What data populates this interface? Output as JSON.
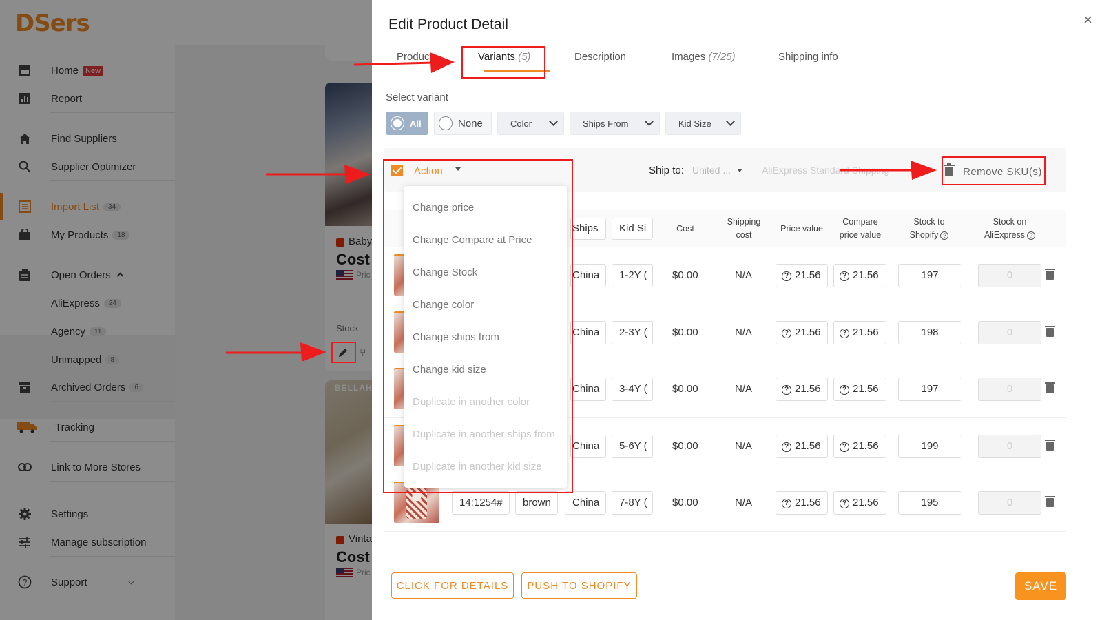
{
  "app": {
    "logo": "DSers",
    "brand_color": "#f08a24",
    "annotation_color": "#ee1c1c"
  },
  "sidebar": {
    "home": {
      "label": "Home",
      "badge": "New",
      "icon": "home-store-icon"
    },
    "report": {
      "label": "Report",
      "icon": "report-chart-icon"
    },
    "find_suppliers": {
      "label": "Find Suppliers",
      "icon": "house-icon"
    },
    "supplier_optimizer": {
      "label": "Supplier Optimizer",
      "icon": "search-icon"
    },
    "import_list": {
      "label": "Import List",
      "count": "34",
      "icon": "list-icon"
    },
    "my_products": {
      "label": "My Products",
      "count": "18",
      "icon": "bag-icon"
    },
    "open_orders": {
      "label": "Open Orders",
      "icon": "clipboard-icon"
    },
    "aliexpress": {
      "label": "AliExpress",
      "count": "24"
    },
    "agency": {
      "label": "Agency",
      "count": "11"
    },
    "unmapped": {
      "label": "Unmapped",
      "count": "8"
    },
    "archived_orders": {
      "label": "Archived Orders",
      "count": "6",
      "icon": "archive-icon"
    },
    "tracking": {
      "label": "Tracking",
      "icon": "truck-icon"
    },
    "link_stores": {
      "label": "Link to More Stores",
      "icon": "link-icon"
    },
    "settings": {
      "label": "Settings",
      "icon": "gear-icon"
    },
    "manage_subscription": {
      "label": "Manage subscription",
      "icon": "sliders-icon"
    },
    "support": {
      "label": "Support",
      "icon": "help-circle-icon"
    }
  },
  "background_cards": {
    "card1": {
      "name": "Baby",
      "cost": "Cost :",
      "price_prefix": "Pric",
      "stock_label": "Stock"
    },
    "card2": {
      "brand": "BELLAH",
      "name": "Vinta",
      "cost": "Cost :",
      "price_prefix": "Pric"
    }
  },
  "drawer": {
    "title": "Edit Product Detail",
    "close": "×",
    "tabs": [
      {
        "label": "Product",
        "count": ""
      },
      {
        "label": "Variants",
        "count": "(5)"
      },
      {
        "label": "Description",
        "count": ""
      },
      {
        "label": "Images",
        "count": "(7/25)"
      },
      {
        "label": "Shipping info",
        "count": ""
      }
    ],
    "select_variant_label": "Select variant",
    "variant_filters": {
      "all": "All",
      "none": "None",
      "color": "Color",
      "ships_from": "Ships From",
      "kid_size": "Kid Size"
    },
    "action_label": "Action",
    "ship_to_label": "Ship to:",
    "ship_to_value": "United ...",
    "shipping_method": "AliExpress Standard Shipping",
    "remove_sku": "Remove SKU(s)",
    "table": {
      "header_inputs": {
        "ships": "Ships",
        "kid_size": "Kid Si"
      },
      "columns": {
        "cost": "Cost",
        "shipping_cost": "Shipping cost",
        "shipping_cost_l1": "Shipping",
        "shipping_cost_l2": "cost",
        "price_value": "Price value",
        "compare_l1": "Compare",
        "compare_l2": "price value",
        "stock_shopify_l1": "Stock to",
        "stock_shopify_l2": "Shopify",
        "stock_ali_l1": "Stock on",
        "stock_ali_l2": "AliExpress"
      },
      "rows": [
        {
          "sku": "",
          "color": "",
          "ships": "China",
          "kid_size": "1-2Y (",
          "cost": "$0.00",
          "shipping": "N/A",
          "price": "21.56",
          "compare": "21.56",
          "stock_shopify": "197",
          "stock_ali": "0"
        },
        {
          "sku": "",
          "color": "",
          "ships": "China",
          "kid_size": "2-3Y (",
          "cost": "$0.00",
          "shipping": "N/A",
          "price": "21.56",
          "compare": "21.56",
          "stock_shopify": "198",
          "stock_ali": "0"
        },
        {
          "sku": "",
          "color": "",
          "ships": "China",
          "kid_size": "3-4Y (",
          "cost": "$0.00",
          "shipping": "N/A",
          "price": "21.56",
          "compare": "21.56",
          "stock_shopify": "197",
          "stock_ali": "0"
        },
        {
          "sku": "",
          "color": "",
          "ships": "China",
          "kid_size": "5-6Y (",
          "cost": "$0.00",
          "shipping": "N/A",
          "price": "21.56",
          "compare": "21.56",
          "stock_shopify": "199",
          "stock_ali": "0"
        },
        {
          "sku": "14:1254#",
          "color": "brown",
          "ships": "China",
          "kid_size": "7-8Y (",
          "cost": "$0.00",
          "shipping": "N/A",
          "price": "21.56",
          "compare": "21.56",
          "stock_shopify": "195",
          "stock_ali": "0"
        }
      ]
    },
    "action_menu": [
      {
        "label": "Change price",
        "enabled": true
      },
      {
        "label": "Change Compare at Price",
        "enabled": true
      },
      {
        "label": "Change Stock",
        "enabled": true
      },
      {
        "label": "Change color",
        "enabled": true
      },
      {
        "label": "Change ships from",
        "enabled": true
      },
      {
        "label": "Change kid size",
        "enabled": true
      },
      {
        "label": "Duplicate in another color",
        "enabled": false
      },
      {
        "label": "Duplicate in another ships from",
        "enabled": false
      },
      {
        "label": "Duplicate in another kid size",
        "enabled": false
      }
    ],
    "footer": {
      "details": "CLICK FOR DETAILS",
      "push": "PUSH TO SHOPIFY",
      "save": "SAVE"
    }
  }
}
